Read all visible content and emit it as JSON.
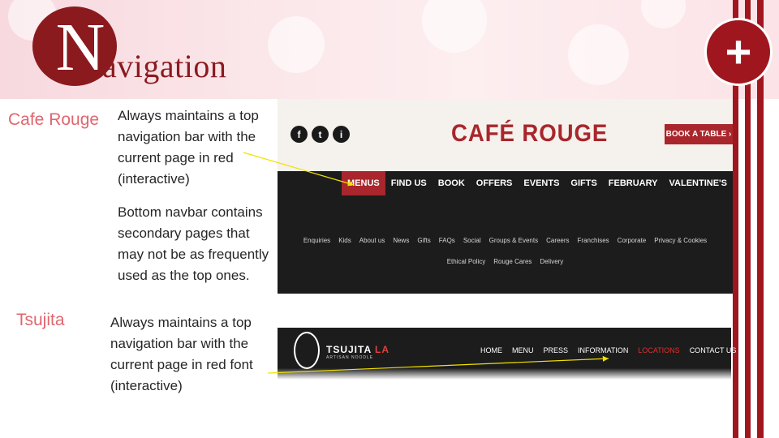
{
  "title": {
    "logo_letter": "N",
    "logo_rest": "avigation"
  },
  "controls": {
    "add_label": "+"
  },
  "colors": {
    "accent": "#a0161e",
    "cafe_rouge_red": "#a8262c",
    "label_pink": "#e0666e"
  },
  "cafe_rouge": {
    "label": "Cafe Rouge",
    "note_top": "Always maintains a top navigation bar with the current page in red (interactive)",
    "note_bottom": "Bottom navbar contains secondary pages that may not be as frequently used as the top ones.",
    "social_icons": [
      "f",
      "t",
      "i"
    ],
    "logo_text": "CAFÉ ROUGE",
    "book_button": "BOOK A TABLE ›",
    "top_nav": [
      "MENUS",
      "FIND US",
      "BOOK",
      "OFFERS",
      "EVENTS",
      "GIFTS",
      "FEBRUARY",
      "VALENTINE'S"
    ],
    "active_item": "MENUS",
    "footer_row1": [
      "Enquiries",
      "Kids",
      "About us",
      "News",
      "Gifts",
      "FAQs",
      "Social",
      "Groups & Events",
      "Careers",
      "Franchises",
      "Corporate",
      "Privacy & Cookies"
    ],
    "footer_row2": [
      "Ethical Policy",
      "Rouge Cares",
      "Delivery"
    ]
  },
  "tsujita": {
    "label": "Tsujita",
    "note": "Always maintains a top navigation bar with the current page in red font (interactive)",
    "brand": "TSUJITA",
    "brand_suffix": "LA",
    "brand_sub": "ARTISAN NOODLE",
    "nav": [
      "HOME",
      "MENU",
      "PRESS",
      "INFORMATION",
      "LOCATIONS",
      "CONTACT US"
    ],
    "active_item": "LOCATIONS"
  }
}
